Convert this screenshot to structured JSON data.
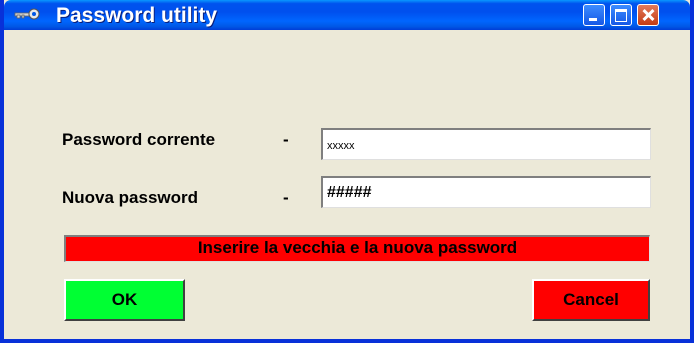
{
  "window": {
    "title": "Password utility",
    "icon": "key-icon",
    "controls": [
      "minimize-icon",
      "maximize-icon",
      "close-icon"
    ],
    "title_color": "#0055ea"
  },
  "form": {
    "current_label": "Password corrente",
    "current_dash": "-",
    "current_value": "xxxxx",
    "new_label": "Nuova password",
    "new_dash": "-",
    "new_value": "#####"
  },
  "status": {
    "message": "Inserire la vecchia e la nuova password",
    "color": "#ff0000"
  },
  "buttons": {
    "ok_label": "OK",
    "ok_color": "#00ff33",
    "cancel_label": "Cancel",
    "cancel_color": "#ff0000"
  }
}
